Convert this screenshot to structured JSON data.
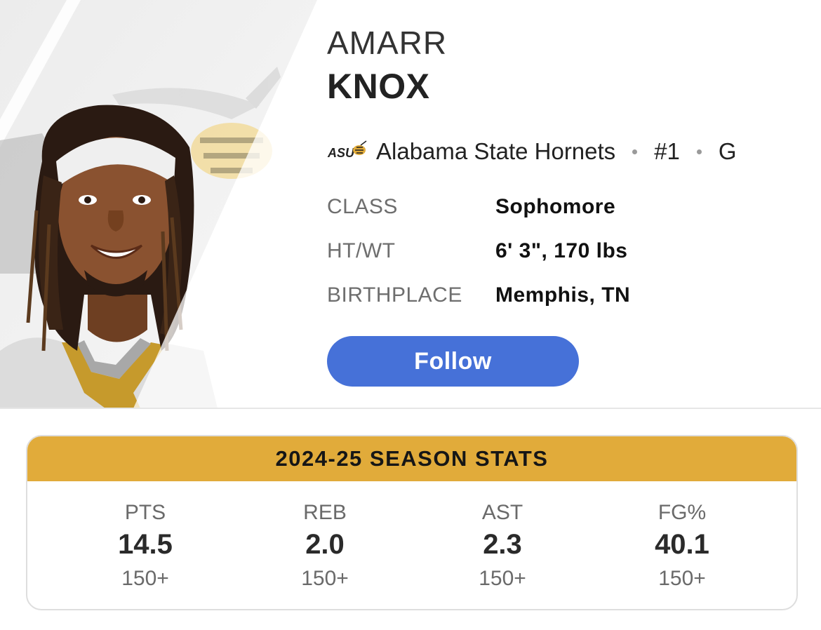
{
  "player": {
    "first_name": "AMARR",
    "last_name": "KNOX",
    "team": "Alabama State Hornets",
    "team_logo_text": "ASU",
    "number": "#1",
    "position": "G"
  },
  "bio": [
    {
      "label": "CLASS",
      "value": "Sophomore"
    },
    {
      "label": "HT/WT",
      "value": "6' 3\", 170 lbs"
    },
    {
      "label": "BIRTHPLACE",
      "value": "Memphis, TN"
    }
  ],
  "follow_label": "Follow",
  "stats": {
    "title": "2024-25 SEASON STATS",
    "items": [
      {
        "label": "PTS",
        "value": "14.5",
        "rank": "150+"
      },
      {
        "label": "REB",
        "value": "2.0",
        "rank": "150+"
      },
      {
        "label": "AST",
        "value": "2.3",
        "rank": "150+"
      },
      {
        "label": "FG%",
        "value": "40.1",
        "rank": "150+"
      }
    ]
  },
  "colors": {
    "accent": "#4671d8",
    "stats_header": "#e1ab3a"
  }
}
